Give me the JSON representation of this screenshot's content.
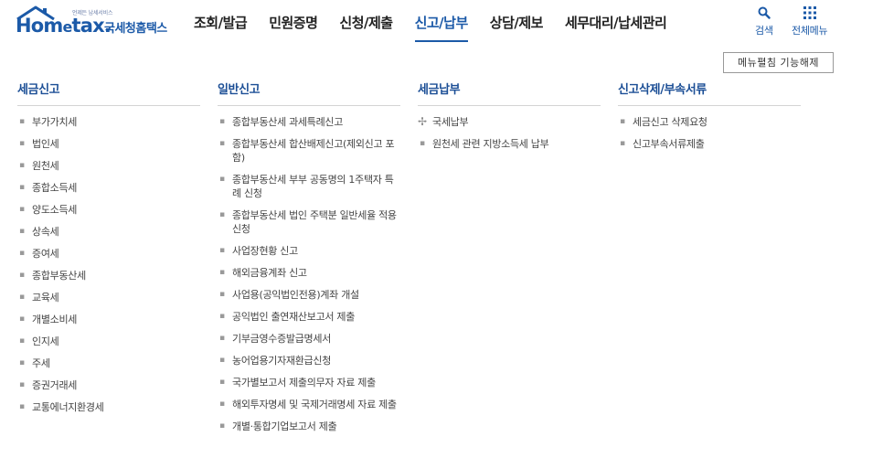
{
  "header": {
    "logo": {
      "tagline": "언제든 납세서비스",
      "brand_ho": "Hom",
      "brand_e": "e",
      "brand_tax": "tax.",
      "subbrand": "국세청홈택스"
    },
    "gnb": [
      {
        "label": "조회/발급",
        "active": false
      },
      {
        "label": "민원증명",
        "active": false
      },
      {
        "label": "신청/제출",
        "active": false
      },
      {
        "label": "신고/납부",
        "active": true
      },
      {
        "label": "상담/제보",
        "active": false
      },
      {
        "label": "세무대리/납세관리",
        "active": false
      }
    ],
    "search_label": "검색",
    "all_menu_label": "전체메뉴"
  },
  "unfold_button_label": "메뉴펼침 기능해제",
  "accent_color": "#1c5aa8",
  "columns": [
    {
      "title": "세금신고",
      "items": [
        "부가가치세",
        "법인세",
        "원천세",
        "종합소득세",
        "양도소득세",
        "상속세",
        "증여세",
        "종합부동산세",
        "교육세",
        "개별소비세",
        "인지세",
        "주세",
        "증권거래세",
        "교통에너지환경세"
      ]
    },
    {
      "title": "일반신고",
      "items": [
        "종합부동산세 과세특례신고",
        "종합부동산세 합산배제신고(제외신고 포함)",
        "종합부동산세 부부 공동명의 1주택자 특례 신청",
        "종합부동산세 법인 주택분 일반세율 적용 신청",
        "사업장현황 신고",
        "해외금융계좌 신고",
        "사업용(공익법인전용)계좌 개설",
        "공익법인 출연재산보고서 제출",
        "기부금영수증발급명세서",
        "농어업용기자재환급신청",
        "국가별보고서 제출의무자 자료 제출",
        "해외투자명세 및 국제거래명세 자료 제출",
        "개별·통합기업보고서 제출"
      ]
    },
    {
      "title": "세금납부",
      "items": [
        "국세납부",
        "원천세 관련 지방소득세 납부"
      ]
    },
    {
      "title": "신고삭제/부속서류",
      "items": [
        "세금신고 삭제요청",
        "신고부속서류제출"
      ]
    }
  ]
}
